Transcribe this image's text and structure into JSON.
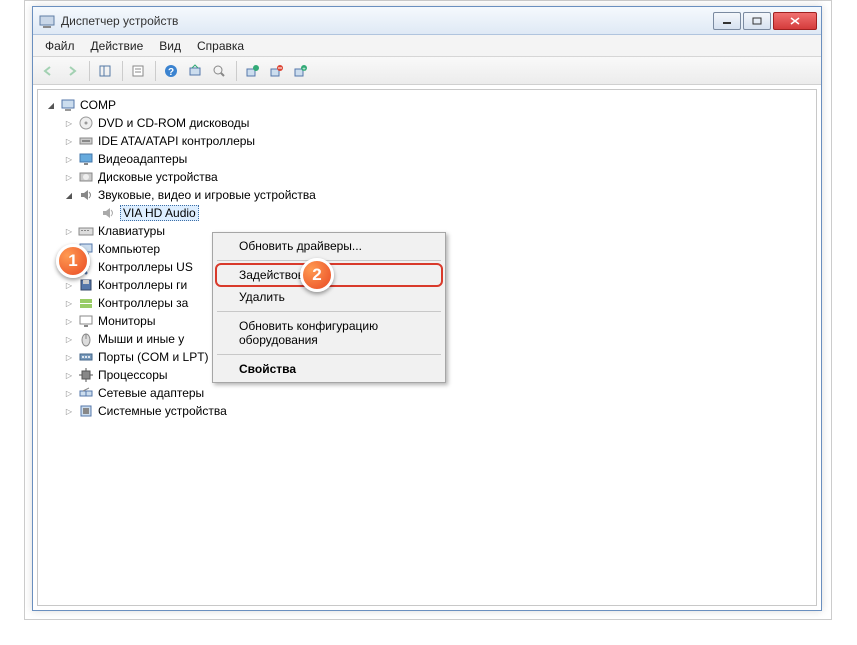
{
  "window": {
    "title": "Диспетчер устройств"
  },
  "menu": {
    "file": "Файл",
    "action": "Действие",
    "view": "Вид",
    "help": "Справка"
  },
  "toolbar": {
    "back": "back-icon",
    "forward": "forward-icon",
    "console": "console-icon",
    "properties": "properties-icon",
    "help": "help-icon",
    "refresh": "refresh-icon",
    "scan": "scan-icon",
    "enable": "enable-icon",
    "uninstall": "uninstall-icon",
    "update": "update-icon"
  },
  "tree": {
    "root": "COMP",
    "items": [
      {
        "label": "DVD и CD-ROM дисководы",
        "icon": "disc"
      },
      {
        "label": "IDE ATA/ATAPI контроллеры",
        "icon": "ide"
      },
      {
        "label": "Видеоадаптеры",
        "icon": "display"
      },
      {
        "label": "Дисковые устройства",
        "icon": "hdd"
      },
      {
        "label": "Звуковые, видео и игровые устройства",
        "icon": "sound",
        "expanded": true
      },
      {
        "label": "VIA HD Audio",
        "icon": "speaker",
        "child": true,
        "selected": true
      },
      {
        "label": "Клавиатуры",
        "icon": "keyboard"
      },
      {
        "label": "Компьютер",
        "icon": "computer"
      },
      {
        "label": "Контроллеры US",
        "icon": "usb"
      },
      {
        "label": "Контроллеры ги",
        "icon": "floppy"
      },
      {
        "label": "Контроллеры за",
        "icon": "storage"
      },
      {
        "label": "Мониторы",
        "icon": "monitor"
      },
      {
        "label": "Мыши и иные у",
        "icon": "mouse"
      },
      {
        "label": "Порты (COM и LPT)",
        "icon": "port"
      },
      {
        "label": "Процессоры",
        "icon": "cpu"
      },
      {
        "label": "Сетевые адаптеры",
        "icon": "net"
      },
      {
        "label": "Системные устройства",
        "icon": "system"
      }
    ]
  },
  "context_menu": {
    "update_drivers": "Обновить драйверы...",
    "enable": "Задействовать",
    "delete": "Удалить",
    "scan_hw": "Обновить конфигурацию оборудования",
    "properties": "Свойства"
  },
  "callouts": {
    "one": "1",
    "two": "2"
  }
}
